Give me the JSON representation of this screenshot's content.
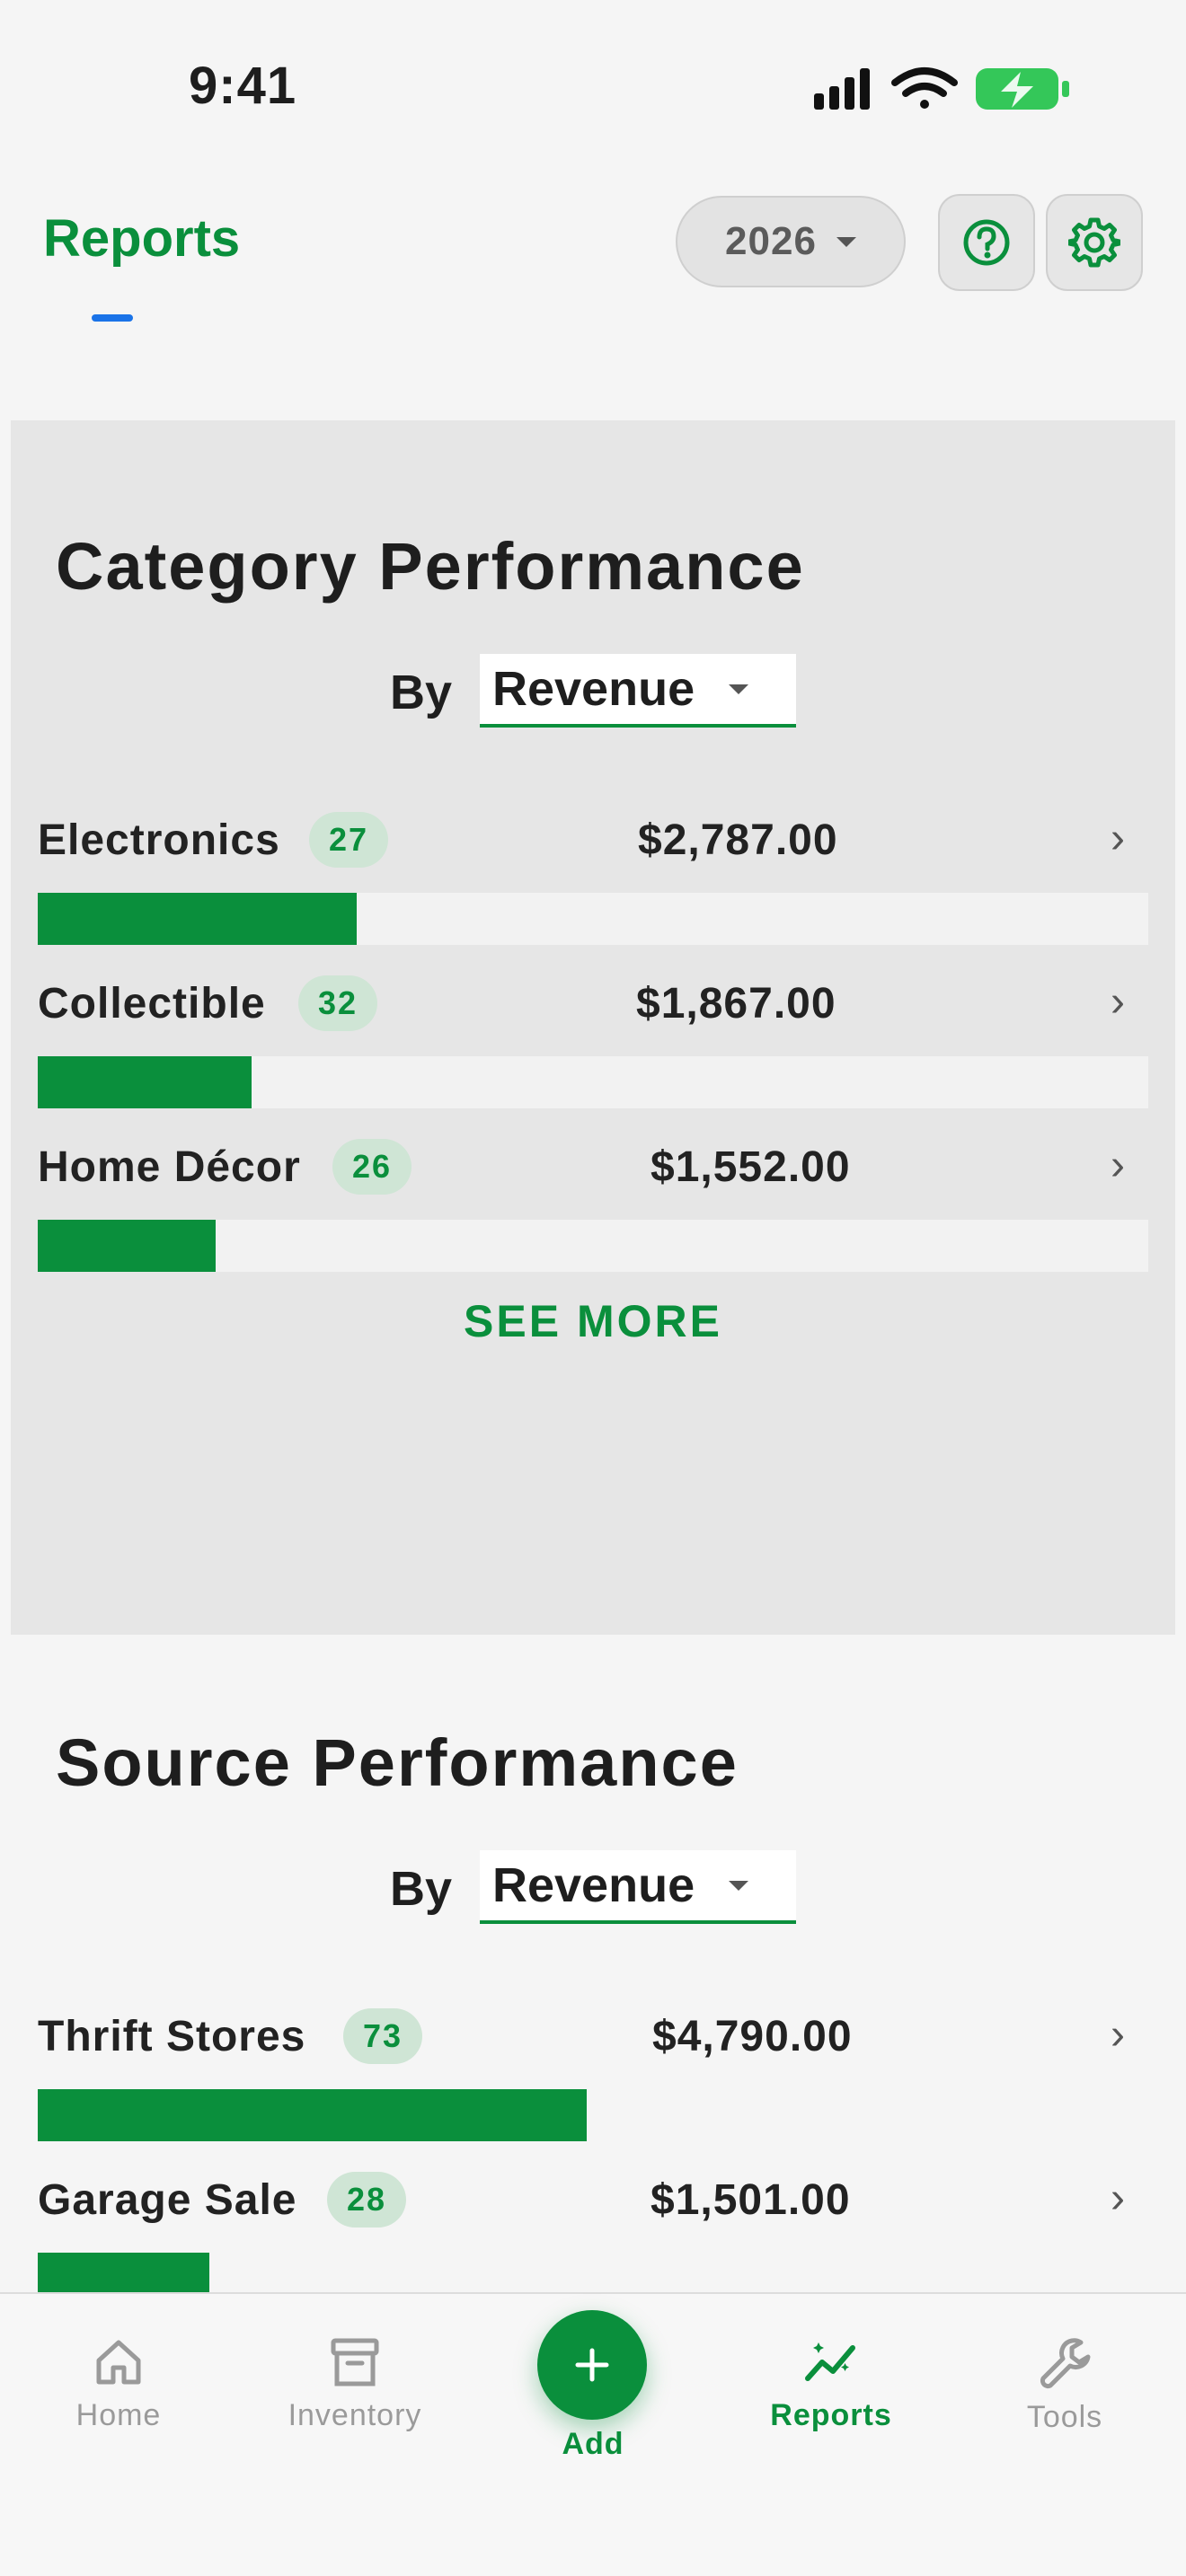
{
  "status_bar": {
    "time": "9:41"
  },
  "header": {
    "title": "Reports",
    "year": "2026"
  },
  "category_performance": {
    "title": "Category Performance",
    "by_label": "By",
    "selected_metric": "Revenue",
    "items": [
      {
        "name": "Electronics",
        "count": "27",
        "value": "$2,787.00",
        "fraction": 0.2876
      },
      {
        "name": "Collectible",
        "count": "32",
        "value": "$1,867.00",
        "fraction": 0.1926
      },
      {
        "name": "Home Décor",
        "count": "26",
        "value": "$1,552.00",
        "fraction": 0.1601
      }
    ],
    "see_more": "SEE MORE"
  },
  "source_performance": {
    "title": "Source Performance",
    "by_label": "By",
    "selected_metric": "Revenue",
    "items": [
      {
        "name": "Thrift Stores",
        "count": "73",
        "value": "$4,790.00",
        "fraction": 0.4942
      },
      {
        "name": "Garage Sale",
        "count": "28",
        "value": "$1,501.00",
        "fraction": 0.1549
      }
    ]
  },
  "bottom_nav": {
    "home": "Home",
    "inventory": "Inventory",
    "add": "Add",
    "reports": "Reports",
    "tools": "Tools"
  },
  "colors": {
    "accent": "#0a8f3c",
    "badge_bg": "#cfe5d5",
    "track": "#f2f2f2",
    "card_bg": "#e6e6e6",
    "page_bg": "#f5f5f5"
  }
}
